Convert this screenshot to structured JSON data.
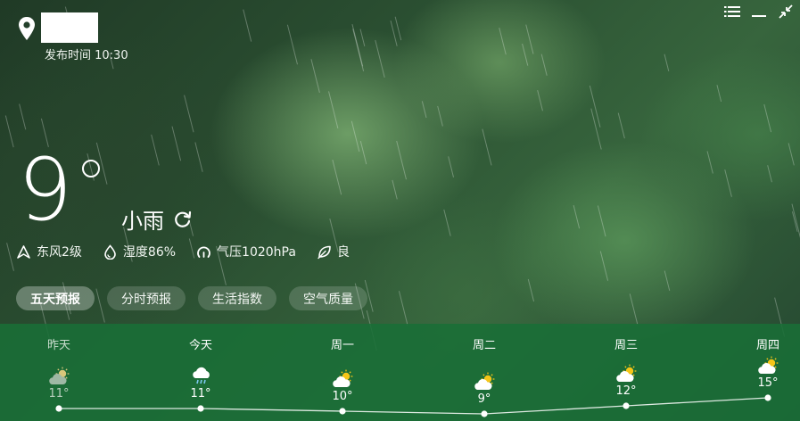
{
  "header": {
    "publish_time": "发布时间 10:30"
  },
  "window_controls": {
    "icons": [
      "menu-icon",
      "minimize-icon",
      "collapse-icon"
    ]
  },
  "current": {
    "temperature": "9",
    "condition": "小雨",
    "wind": "东风2级",
    "humidity": "湿度86%",
    "pressure": "气压1020hPa",
    "air_quality": "良"
  },
  "tabs": [
    {
      "label": "五天预报",
      "active": true
    },
    {
      "label": "分时预报",
      "active": false
    },
    {
      "label": "生活指数",
      "active": false
    },
    {
      "label": "空气质量",
      "active": false
    }
  ],
  "forecast": [
    {
      "day": "昨天",
      "temp": "11°",
      "temp_value": 11,
      "icon": "cloudy-icon",
      "past": true
    },
    {
      "day": "今天",
      "temp": "11°",
      "temp_value": 11,
      "icon": "light-rain-icon",
      "past": false
    },
    {
      "day": "周一",
      "temp": "10°",
      "temp_value": 10,
      "icon": "partly-cloudy-icon",
      "past": false
    },
    {
      "day": "周二",
      "temp": "9°",
      "temp_value": 9,
      "icon": "partly-cloudy-icon",
      "past": false
    },
    {
      "day": "周三",
      "temp": "12°",
      "temp_value": 12,
      "icon": "partly-cloudy-icon",
      "past": false
    },
    {
      "day": "周四",
      "temp": "15°",
      "temp_value": 15,
      "icon": "partly-cloudy-icon",
      "past": false
    }
  ],
  "colors": {
    "forecast_bg": "#1e6e37",
    "sun": "#f5c518",
    "cloud": "#ffffff",
    "past_cloud": "#9fb8a4"
  }
}
